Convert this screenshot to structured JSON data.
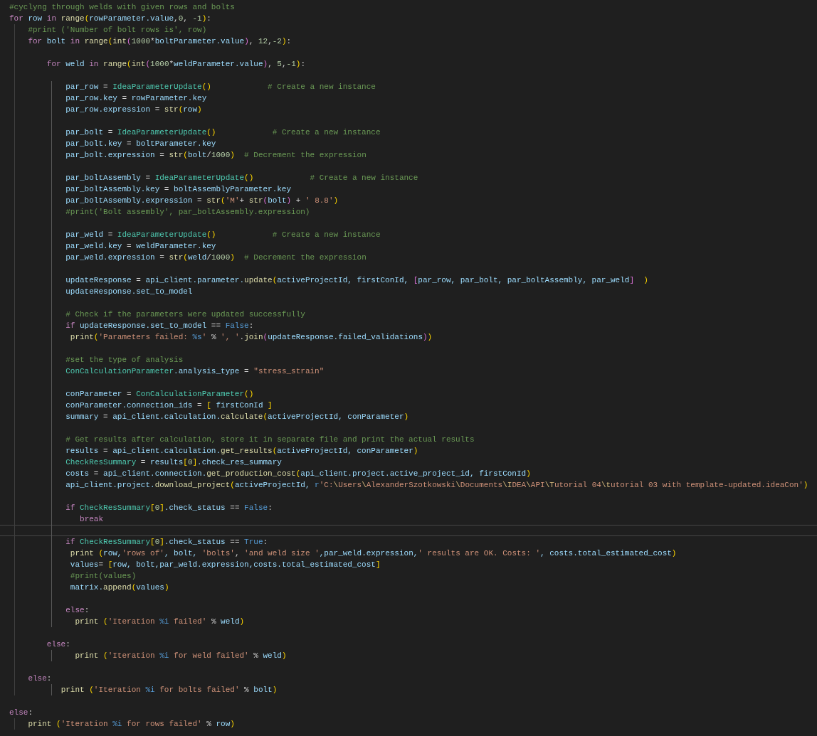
{
  "editor": {
    "lines": [
      {
        "current": false,
        "tokens": [
          {
            "text": "#cyclyng through welds with given rows and bolts",
            "kind": "comment"
          }
        ]
      },
      {
        "current": false,
        "tokens": [
          {
            "text": "for",
            "kind": "keyword"
          },
          {
            "text": " row ",
            "kind": "variable"
          },
          {
            "text": "in ",
            "kind": "keyword"
          },
          {
            "text": "range",
            "kind": "function"
          },
          {
            "text": "(",
            "kind": "bracket"
          },
          {
            "text": "rowParameter.value",
            "kind": "variable"
          },
          {
            "text": ",",
            "kind": "operator"
          },
          {
            "text": "0",
            "kind": "number"
          },
          {
            "text": ", ",
            "kind": "operator"
          },
          {
            "text": "-1",
            "kind": "number"
          },
          {
            "text": ")",
            "kind": "bracket"
          },
          {
            "text": ":",
            "kind": "operator"
          }
        ]
      },
      {
        "current": false,
        "tokens": [
          {
            "text": "    #print ('Number of bolt rows is', row)",
            "kind": "comment"
          }
        ]
      },
      {
        "current": false,
        "tokens": [
          {
            "text": "    for",
            "kind": "keyword"
          },
          {
            "text": " bolt ",
            "kind": "variable"
          },
          {
            "text": "in ",
            "kind": "keyword"
          },
          {
            "text": "range",
            "kind": "function"
          },
          {
            "text": "(",
            "kind": "bracket"
          },
          {
            "text": "int",
            "kind": "function"
          },
          {
            "text": "(",
            "kind": "inner"
          },
          {
            "text": "1000",
            "kind": "number"
          },
          {
            "text": "*",
            "kind": "operator"
          },
          {
            "text": "boltParameter.value",
            "kind": "variable"
          },
          {
            "text": ")",
            "kind": "inner"
          },
          {
            "text": ", ",
            "kind": "operator"
          },
          {
            "text": "12",
            "kind": "number"
          },
          {
            "text": ",",
            "kind": "operator"
          },
          {
            "text": "-2",
            "kind": "number"
          },
          {
            "text": ")",
            "kind": "bracket"
          },
          {
            "text": ":",
            "kind": "operator"
          }
        ]
      },
      {
        "current": false
      },
      {
        "current": false,
        "tokens": [
          {
            "text": "        for",
            "kind": "keyword"
          },
          {
            "text": " weld ",
            "kind": "variable"
          },
          {
            "text": "in ",
            "kind": "keyword"
          },
          {
            "text": "range",
            "kind": "function"
          },
          {
            "text": "(",
            "kind": "bracket"
          },
          {
            "text": "int",
            "kind": "function"
          },
          {
            "text": "(",
            "kind": "inner"
          },
          {
            "text": "1000",
            "kind": "number"
          },
          {
            "text": "*",
            "kind": "operator"
          },
          {
            "text": "weldParameter.value",
            "kind": "variable"
          },
          {
            "text": ")",
            "kind": "inner"
          },
          {
            "text": ", ",
            "kind": "operator"
          },
          {
            "text": "5",
            "kind": "number"
          },
          {
            "text": ",",
            "kind": "operator"
          },
          {
            "text": "-1",
            "kind": "number"
          },
          {
            "text": ")",
            "kind": "bracket"
          },
          {
            "text": ":",
            "kind": "operator"
          }
        ]
      },
      {
        "current": false
      },
      {
        "current": false,
        "tokens": [
          {
            "text": "            par_row ",
            "kind": "variable"
          },
          {
            "text": "= ",
            "kind": "operator"
          },
          {
            "text": "IdeaParameterUpdate",
            "kind": "class"
          },
          {
            "text": "()",
            "kind": "bracket"
          },
          {
            "text": "            # Create a new instance",
            "kind": "comment"
          }
        ]
      },
      {
        "current": false,
        "tokens": [
          {
            "text": "            par_row.key ",
            "kind": "variable"
          },
          {
            "text": "= ",
            "kind": "operator"
          },
          {
            "text": "rowParameter.key",
            "kind": "variable"
          }
        ]
      },
      {
        "current": false,
        "tokens": [
          {
            "text": "            par_row.expression ",
            "kind": "variable"
          },
          {
            "text": "= ",
            "kind": "operator"
          },
          {
            "text": "str",
            "kind": "function"
          },
          {
            "text": "(",
            "kind": "bracket"
          },
          {
            "text": "row",
            "kind": "variable"
          },
          {
            "text": ")",
            "kind": "bracket"
          }
        ]
      },
      {
        "current": false
      },
      {
        "current": false,
        "tokens": [
          {
            "text": "            par_bolt ",
            "kind": "variable"
          },
          {
            "text": "= ",
            "kind": "operator"
          },
          {
            "text": "IdeaParameterUpdate",
            "kind": "class"
          },
          {
            "text": "()",
            "kind": "bracket"
          },
          {
            "text": "            # Create a new instance",
            "kind": "comment"
          }
        ]
      },
      {
        "current": false,
        "tokens": [
          {
            "text": "            par_bolt.key ",
            "kind": "variable"
          },
          {
            "text": "= ",
            "kind": "operator"
          },
          {
            "text": "boltParameter.key",
            "kind": "variable"
          }
        ]
      },
      {
        "current": false,
        "tokens": [
          {
            "text": "            par_bolt.expression ",
            "kind": "variable"
          },
          {
            "text": "= ",
            "kind": "operator"
          },
          {
            "text": "str",
            "kind": "function"
          },
          {
            "text": "(",
            "kind": "bracket"
          },
          {
            "text": "bolt",
            "kind": "variable"
          },
          {
            "text": "/",
            "kind": "operator"
          },
          {
            "text": "1000",
            "kind": "number"
          },
          {
            "text": ")",
            "kind": "bracket"
          },
          {
            "text": "  # Decrement the expression",
            "kind": "comment"
          }
        ]
      },
      {
        "current": false
      },
      {
        "current": false,
        "tokens": [
          {
            "text": "            par_boltAssembly ",
            "kind": "variable"
          },
          {
            "text": "= ",
            "kind": "operator"
          },
          {
            "text": "IdeaParameterUpdate",
            "kind": "class"
          },
          {
            "text": "()",
            "kind": "bracket"
          },
          {
            "text": "            # Create a new instance",
            "kind": "comment"
          }
        ]
      },
      {
        "current": false,
        "tokens": [
          {
            "text": "            par_boltAssembly.key ",
            "kind": "variable"
          },
          {
            "text": "= ",
            "kind": "operator"
          },
          {
            "text": "boltAssemblyParameter.key",
            "kind": "variable"
          }
        ]
      },
      {
        "current": false,
        "tokens": [
          {
            "text": "            par_boltAssembly.expression ",
            "kind": "variable"
          },
          {
            "text": "= ",
            "kind": "operator"
          },
          {
            "text": "str",
            "kind": "function"
          },
          {
            "text": "(",
            "kind": "bracket"
          },
          {
            "text": "'M'",
            "kind": "string"
          },
          {
            "text": "+ ",
            "kind": "operator"
          },
          {
            "text": "str",
            "kind": "function"
          },
          {
            "text": "(",
            "kind": "inner"
          },
          {
            "text": "bolt",
            "kind": "variable"
          },
          {
            "text": ")",
            "kind": "inner"
          },
          {
            "text": " + ",
            "kind": "operator"
          },
          {
            "text": "' 8.8'",
            "kind": "string"
          },
          {
            "text": ")",
            "kind": "bracket"
          }
        ]
      },
      {
        "current": false,
        "tokens": [
          {
            "text": "            #print('Bolt assembly', par_boltAssembly.expression)",
            "kind": "comment"
          }
        ]
      },
      {
        "current": false
      },
      {
        "current": false,
        "tokens": [
          {
            "text": "            par_weld ",
            "kind": "variable"
          },
          {
            "text": "= ",
            "kind": "operator"
          },
          {
            "text": "IdeaParameterUpdate",
            "kind": "class"
          },
          {
            "text": "()",
            "kind": "bracket"
          },
          {
            "text": "            # Create a new instance",
            "kind": "comment"
          }
        ]
      },
      {
        "current": false,
        "tokens": [
          {
            "text": "            par_weld.key ",
            "kind": "variable"
          },
          {
            "text": "= ",
            "kind": "operator"
          },
          {
            "text": "weldParameter.key",
            "kind": "variable"
          }
        ]
      },
      {
        "current": false,
        "tokens": [
          {
            "text": "            par_weld.expression ",
            "kind": "variable"
          },
          {
            "text": "= ",
            "kind": "operator"
          },
          {
            "text": "str",
            "kind": "function"
          },
          {
            "text": "(",
            "kind": "bracket"
          },
          {
            "text": "weld",
            "kind": "variable"
          },
          {
            "text": "/",
            "kind": "operator"
          },
          {
            "text": "1000",
            "kind": "number"
          },
          {
            "text": ")",
            "kind": "bracket"
          },
          {
            "text": "  # Decrement the expression",
            "kind": "comment"
          }
        ]
      },
      {
        "current": false
      },
      {
        "current": false,
        "tokens": [
          {
            "text": "            updateResponse ",
            "kind": "variable"
          },
          {
            "text": "= ",
            "kind": "operator"
          },
          {
            "text": "api_client.parameter.",
            "kind": "variable"
          },
          {
            "text": "update",
            "kind": "function"
          },
          {
            "text": "(",
            "kind": "bracket"
          },
          {
            "text": "activeProjectId, firstConId, ",
            "kind": "variable"
          },
          {
            "text": "[",
            "kind": "inner"
          },
          {
            "text": "par_row, par_bolt, par_boltAssembly, par_weld",
            "kind": "variable"
          },
          {
            "text": "]  ",
            "kind": "inner"
          },
          {
            "text": ")",
            "kind": "bracket"
          }
        ]
      },
      {
        "current": false,
        "tokens": [
          {
            "text": "            updateResponse.set_to_model",
            "kind": "variable"
          }
        ]
      },
      {
        "current": false
      },
      {
        "current": false,
        "tokens": [
          {
            "text": "            # Check if the parameters were updated successfully",
            "kind": "comment"
          }
        ]
      },
      {
        "current": false,
        "tokens": [
          {
            "text": "            if",
            "kind": "keyword"
          },
          {
            "text": " updateResponse.set_to_model ",
            "kind": "variable"
          },
          {
            "text": "== ",
            "kind": "operator"
          },
          {
            "text": "False",
            "kind": "constant"
          },
          {
            "text": ":",
            "kind": "operator"
          }
        ]
      },
      {
        "current": false,
        "tokens": [
          {
            "text": "             print",
            "kind": "function"
          },
          {
            "text": "(",
            "kind": "bracket"
          },
          {
            "text": "'Parameters failed: ",
            "kind": "string"
          },
          {
            "text": "%s",
            "kind": "format"
          },
          {
            "text": "'",
            "kind": "string"
          },
          {
            "text": " % ",
            "kind": "operator"
          },
          {
            "text": "', '",
            "kind": "string"
          },
          {
            "text": ".",
            "kind": "operator"
          },
          {
            "text": "join",
            "kind": "function"
          },
          {
            "text": "(",
            "kind": "inner"
          },
          {
            "text": "updateResponse.failed_validations",
            "kind": "variable"
          },
          {
            "text": ")",
            "kind": "inner"
          },
          {
            "text": ")",
            "kind": "bracket"
          }
        ]
      },
      {
        "current": false
      },
      {
        "current": false,
        "tokens": [
          {
            "text": "            #set the type of analysis",
            "kind": "comment"
          }
        ]
      },
      {
        "current": false,
        "tokens": [
          {
            "text": "            ConCalculationParameter",
            "kind": "class"
          },
          {
            "text": ".analysis_type ",
            "kind": "variable"
          },
          {
            "text": "= ",
            "kind": "operator"
          },
          {
            "text": "\"stress_strain\"",
            "kind": "string"
          }
        ]
      },
      {
        "current": false
      },
      {
        "current": false,
        "tokens": [
          {
            "text": "            conParameter ",
            "kind": "variable"
          },
          {
            "text": "= ",
            "kind": "operator"
          },
          {
            "text": "ConCalculationParameter",
            "kind": "class"
          },
          {
            "text": "()",
            "kind": "bracket"
          }
        ]
      },
      {
        "current": false,
        "tokens": [
          {
            "text": "            conParameter.connection_ids ",
            "kind": "variable"
          },
          {
            "text": "= ",
            "kind": "operator"
          },
          {
            "text": "[",
            "kind": "bracket"
          },
          {
            "text": " firstConId ",
            "kind": "variable"
          },
          {
            "text": "]",
            "kind": "bracket"
          }
        ]
      },
      {
        "current": false,
        "tokens": [
          {
            "text": "            summary ",
            "kind": "variable"
          },
          {
            "text": "= ",
            "kind": "operator"
          },
          {
            "text": "api_client.calculation.",
            "kind": "variable"
          },
          {
            "text": "calculate",
            "kind": "function"
          },
          {
            "text": "(",
            "kind": "bracket"
          },
          {
            "text": "activeProjectId, conParameter",
            "kind": "variable"
          },
          {
            "text": ")",
            "kind": "bracket"
          }
        ]
      },
      {
        "current": false
      },
      {
        "current": false,
        "tokens": [
          {
            "text": "            # Get results after calculation, store it in separate file and print the actual results",
            "kind": "comment"
          }
        ]
      },
      {
        "current": false,
        "tokens": [
          {
            "text": "            results ",
            "kind": "variable"
          },
          {
            "text": "= ",
            "kind": "operator"
          },
          {
            "text": "api_client.calculation.",
            "kind": "variable"
          },
          {
            "text": "get_results",
            "kind": "function"
          },
          {
            "text": "(",
            "kind": "bracket"
          },
          {
            "text": "activeProjectId, conParameter",
            "kind": "variable"
          },
          {
            "text": ")",
            "kind": "bracket"
          }
        ]
      },
      {
        "current": false,
        "tokens": [
          {
            "text": "            CheckResSummary ",
            "kind": "class"
          },
          {
            "text": "= ",
            "kind": "operator"
          },
          {
            "text": "results",
            "kind": "variable"
          },
          {
            "text": "[",
            "kind": "bracket"
          },
          {
            "text": "0",
            "kind": "number"
          },
          {
            "text": "]",
            "kind": "bracket"
          },
          {
            "text": ".check_res_summary",
            "kind": "variable"
          }
        ]
      },
      {
        "current": false,
        "tokens": [
          {
            "text": "            costs ",
            "kind": "variable"
          },
          {
            "text": "= ",
            "kind": "operator"
          },
          {
            "text": "api_client.connection.",
            "kind": "variable"
          },
          {
            "text": "get_production_cost",
            "kind": "function"
          },
          {
            "text": "(",
            "kind": "bracket"
          },
          {
            "text": "api_client.project.active_project_id, firstConId",
            "kind": "variable"
          },
          {
            "text": ")",
            "kind": "bracket"
          }
        ]
      },
      {
        "current": false,
        "tokens": [
          {
            "text": "            api_client.project.",
            "kind": "variable"
          },
          {
            "text": "download_project",
            "kind": "function"
          },
          {
            "text": "(",
            "kind": "bracket"
          },
          {
            "text": "activeProjectId, ",
            "kind": "variable"
          },
          {
            "text": "r",
            "kind": "constant"
          },
          {
            "text": "'C:",
            "kind": "string"
          },
          {
            "text": "\\",
            "kind": "escape"
          },
          {
            "text": "Users",
            "kind": "string"
          },
          {
            "text": "\\",
            "kind": "escape"
          },
          {
            "text": "AlexanderSzotkowski",
            "kind": "string"
          },
          {
            "text": "\\",
            "kind": "escape"
          },
          {
            "text": "Documents",
            "kind": "string"
          },
          {
            "text": "\\",
            "kind": "escape"
          },
          {
            "text": "I",
            "kind": "escape"
          },
          {
            "text": "DEA",
            "kind": "string"
          },
          {
            "text": "\\",
            "kind": "escape"
          },
          {
            "text": "API",
            "kind": "string"
          },
          {
            "text": "\\",
            "kind": "escape"
          },
          {
            "text": "T",
            "kind": "escape"
          },
          {
            "text": "utorial 04",
            "kind": "string"
          },
          {
            "text": "\\",
            "kind": "escape"
          },
          {
            "text": "t",
            "kind": "escape"
          },
          {
            "text": "utorial 03 with template-updated.ideaCon'",
            "kind": "string"
          },
          {
            "text": ")",
            "kind": "bracket"
          }
        ]
      },
      {
        "current": false
      },
      {
        "current": false,
        "tokens": [
          {
            "text": "            if",
            "kind": "keyword"
          },
          {
            "text": " CheckResSummary",
            "kind": "class"
          },
          {
            "text": "[",
            "kind": "bracket"
          },
          {
            "text": "0",
            "kind": "number"
          },
          {
            "text": "]",
            "kind": "bracket"
          },
          {
            "text": ".check_status ",
            "kind": "variable"
          },
          {
            "text": "== ",
            "kind": "operator"
          },
          {
            "text": "False",
            "kind": "constant"
          },
          {
            "text": ":",
            "kind": "operator"
          }
        ]
      },
      {
        "current": false,
        "tokens": [
          {
            "text": "               break",
            "kind": "keyword"
          }
        ]
      },
      {
        "current": true
      },
      {
        "current": false,
        "tokens": [
          {
            "text": "            if",
            "kind": "keyword"
          },
          {
            "text": " CheckResSummary",
            "kind": "class"
          },
          {
            "text": "[",
            "kind": "bracket"
          },
          {
            "text": "0",
            "kind": "number"
          },
          {
            "text": "]",
            "kind": "bracket"
          },
          {
            "text": ".check_status ",
            "kind": "variable"
          },
          {
            "text": "== ",
            "kind": "operator"
          },
          {
            "text": "True",
            "kind": "constant"
          },
          {
            "text": ":",
            "kind": "operator"
          }
        ]
      },
      {
        "current": false,
        "tokens": [
          {
            "text": "             print ",
            "kind": "function"
          },
          {
            "text": "(",
            "kind": "bracket"
          },
          {
            "text": "row,",
            "kind": "variable"
          },
          {
            "text": "'rows of'",
            "kind": "string"
          },
          {
            "text": ", bolt, ",
            "kind": "variable"
          },
          {
            "text": "'bolts'",
            "kind": "string"
          },
          {
            "text": ", ",
            "kind": "operator"
          },
          {
            "text": "'and weld size '",
            "kind": "string"
          },
          {
            "text": ",par_weld.expression,",
            "kind": "variable"
          },
          {
            "text": "' results are OK. Costs: '",
            "kind": "string"
          },
          {
            "text": ", costs.total_estimated_cost",
            "kind": "variable"
          },
          {
            "text": ")",
            "kind": "bracket"
          }
        ]
      },
      {
        "current": false,
        "tokens": [
          {
            "text": "             values",
            "kind": "variable"
          },
          {
            "text": "= ",
            "kind": "operator"
          },
          {
            "text": "[",
            "kind": "bracket"
          },
          {
            "text": "row, bolt,par_weld.expression,costs.total_estimated_cost",
            "kind": "variable"
          },
          {
            "text": "]",
            "kind": "bracket"
          }
        ]
      },
      {
        "current": false,
        "tokens": [
          {
            "text": "             #print(values)",
            "kind": "comment"
          }
        ]
      },
      {
        "current": false,
        "tokens": [
          {
            "text": "             matrix.",
            "kind": "variable"
          },
          {
            "text": "append",
            "kind": "function"
          },
          {
            "text": "(",
            "kind": "bracket"
          },
          {
            "text": "values",
            "kind": "variable"
          },
          {
            "text": ")",
            "kind": "bracket"
          }
        ]
      },
      {
        "current": false
      },
      {
        "current": false,
        "tokens": [
          {
            "text": "            else",
            "kind": "keyword"
          },
          {
            "text": ":",
            "kind": "operator"
          }
        ]
      },
      {
        "current": false,
        "tokens": [
          {
            "text": "              print ",
            "kind": "function"
          },
          {
            "text": "(",
            "kind": "bracket"
          },
          {
            "text": "'Iteration ",
            "kind": "string"
          },
          {
            "text": "%i",
            "kind": "format"
          },
          {
            "text": " failed'",
            "kind": "string"
          },
          {
            "text": " % ",
            "kind": "operator"
          },
          {
            "text": "weld",
            "kind": "variable"
          },
          {
            "text": ")",
            "kind": "bracket"
          }
        ]
      },
      {
        "current": false
      },
      {
        "current": false,
        "tokens": [
          {
            "text": "        else",
            "kind": "keyword"
          },
          {
            "text": ":",
            "kind": "operator"
          }
        ]
      },
      {
        "current": false,
        "tokens": [
          {
            "text": "              print ",
            "kind": "function"
          },
          {
            "text": "(",
            "kind": "bracket"
          },
          {
            "text": "'Iteration ",
            "kind": "string"
          },
          {
            "text": "%i",
            "kind": "format"
          },
          {
            "text": " for weld failed'",
            "kind": "string"
          },
          {
            "text": " % ",
            "kind": "operator"
          },
          {
            "text": "weld",
            "kind": "variable"
          },
          {
            "text": ")",
            "kind": "bracket"
          }
        ]
      },
      {
        "current": false
      },
      {
        "current": false,
        "tokens": [
          {
            "text": "    else",
            "kind": "keyword"
          },
          {
            "text": ":",
            "kind": "operator"
          }
        ]
      },
      {
        "current": false,
        "tokens": [
          {
            "text": "           print ",
            "kind": "function"
          },
          {
            "text": "(",
            "kind": "bracket"
          },
          {
            "text": "'Iteration ",
            "kind": "string"
          },
          {
            "text": "%i",
            "kind": "format"
          },
          {
            "text": " for bolts failed'",
            "kind": "string"
          },
          {
            "text": " % ",
            "kind": "operator"
          },
          {
            "text": "bolt",
            "kind": "variable"
          },
          {
            "text": ")",
            "kind": "bracket"
          }
        ]
      },
      {
        "current": false
      },
      {
        "current": false,
        "tokens": [
          {
            "text": "else",
            "kind": "keyword"
          },
          {
            "text": ":",
            "kind": "operator"
          }
        ]
      },
      {
        "current": false,
        "tokens": [
          {
            "text": "    print ",
            "kind": "function"
          },
          {
            "text": "(",
            "kind": "bracket"
          },
          {
            "text": "'Iteration ",
            "kind": "string"
          },
          {
            "text": "%i",
            "kind": "format"
          },
          {
            "text": " for rows failed'",
            "kind": "string"
          },
          {
            "text": " % ",
            "kind": "operator"
          },
          {
            "text": "row",
            "kind": "variable"
          },
          {
            "text": ")",
            "kind": "bracket"
          }
        ]
      }
    ]
  }
}
